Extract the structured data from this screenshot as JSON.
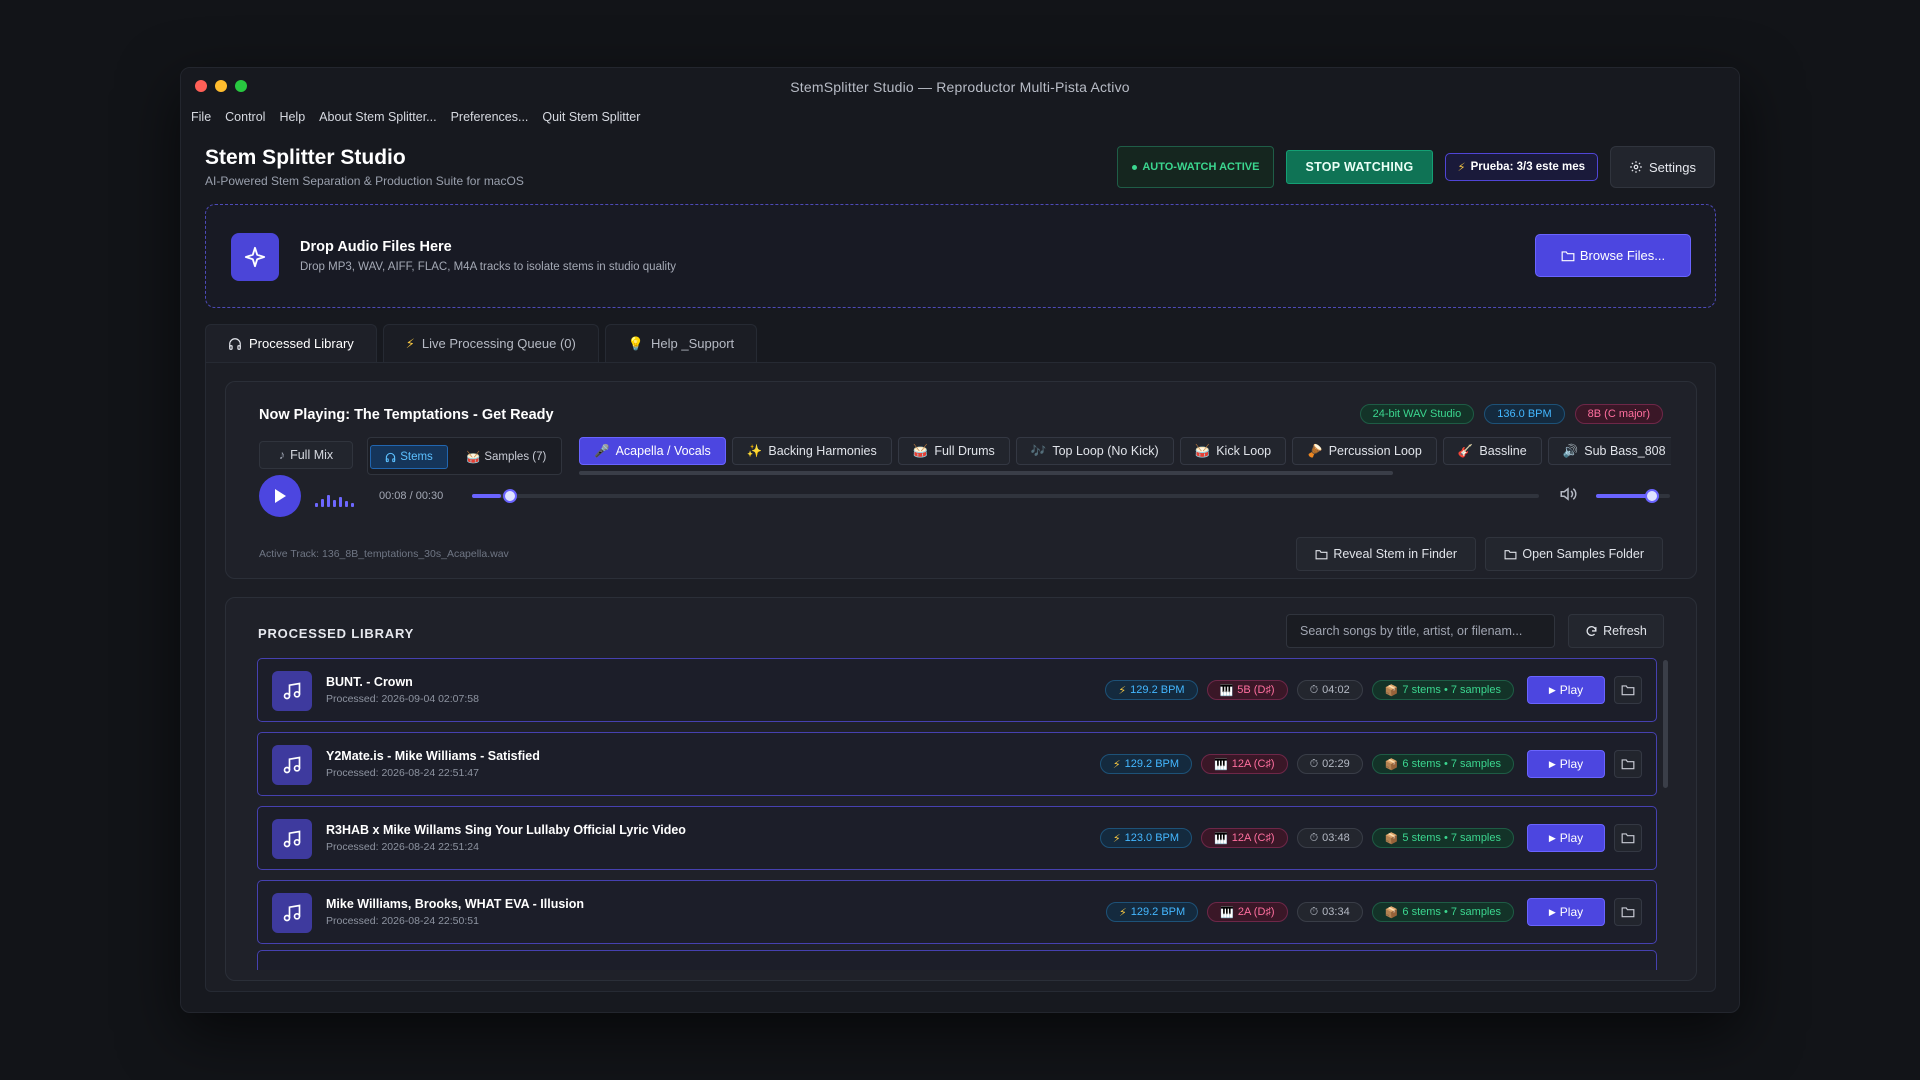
{
  "window": {
    "title": "StemSplitter Studio — Reproductor Multi-Pista Activo",
    "traffic_colors": [
      "#ff5f57",
      "#febc2e",
      "#28c840"
    ]
  },
  "menubar": [
    "File",
    "Control",
    "Help",
    "About Stem Splitter...",
    "Preferences...",
    "Quit Stem Splitter"
  ],
  "header": {
    "title": "Stem Splitter Studio",
    "subtitle": "AI-Powered Stem Separation & Production Suite for macOS",
    "auto_watch": "AUTO-WATCH ACTIVE",
    "stop_watching": "STOP WATCHING",
    "trial": "Prueba: 3/3 este mes",
    "settings": "Settings"
  },
  "dropzone": {
    "title": "Drop Audio Files Here",
    "subtitle": "Drop MP3, WAV, AIFF, FLAC, M4A tracks to isolate stems in studio quality",
    "browse": "Browse Files..."
  },
  "tabs": [
    {
      "label": "Processed Library",
      "icon": "headphones-icon",
      "active": true
    },
    {
      "label": "Live Processing Queue (0)",
      "icon": "lightning-icon",
      "active": false
    },
    {
      "label": "Help _Support",
      "icon": "lightbulb-icon",
      "active": false
    }
  ],
  "player": {
    "now_playing": "Now Playing: The Temptations - Get Ready",
    "badges": {
      "format": "24-bit WAV Studio",
      "bpm": "136.0 BPM",
      "key": "8B (C major)"
    },
    "full_mix": "Full Mix",
    "stems_toggle": "Stems",
    "samples_toggle": "Samples (7)",
    "stem_chips": [
      {
        "label": "Acapella / Vocals",
        "icon": "🎤",
        "active": true
      },
      {
        "label": "Backing Harmonies",
        "icon": "✨",
        "active": false
      },
      {
        "label": "Full Drums",
        "icon": "🥁",
        "active": false
      },
      {
        "label": "Top Loop (No Kick)",
        "icon": "🎶",
        "active": false
      },
      {
        "label": "Kick Loop",
        "icon": "🥁",
        "active": false
      },
      {
        "label": "Percussion Loop",
        "icon": "🪘",
        "active": false
      },
      {
        "label": "Bassline",
        "icon": "🎸",
        "active": false
      },
      {
        "label": "Sub Bass_808",
        "icon": "🔊",
        "active": false
      }
    ],
    "time": "00:08 / 00:30",
    "progress": 0.027,
    "volume": 0.75,
    "active_track": "Active Track: 136_8B_temptations_30s_Acapella.wav",
    "reveal": "Reveal Stem in Finder",
    "open_samples": "Open Samples Folder"
  },
  "library": {
    "title": "PROCESSED LIBRARY",
    "search_placeholder": "Search songs by title, artist, or filenam...",
    "refresh": "Refresh",
    "play_label": "Play",
    "rows": [
      {
        "title": "BUNT. - Crown",
        "date": "Processed: 2026-09-04 02:07:58",
        "bpm": "129.2 BPM",
        "key": "5B (D♯)",
        "duration": "04:02",
        "stems": "7 stems • 7 samples"
      },
      {
        "title": "Y2Mate.is - Mike Williams - Satisfied",
        "date": "Processed: 2026-08-24 22:51:47",
        "bpm": "129.2 BPM",
        "key": "12A (C♯)",
        "duration": "02:29",
        "stems": "6 stems • 7 samples"
      },
      {
        "title": "R3HAB x Mike Willams  Sing Your Lullaby Official Lyric Video",
        "date": "Processed: 2026-08-24 22:51:24",
        "bpm": "123.0 BPM",
        "key": "12A (C♯)",
        "duration": "03:48",
        "stems": "5 stems • 7 samples"
      },
      {
        "title": "Mike Williams, Brooks, WHAT EVA - Illusion",
        "date": "Processed: 2026-08-24 22:50:51",
        "bpm": "129.2 BPM",
        "key": "2A (D♯)",
        "duration": "03:34",
        "stems": "6 stems • 7 samples"
      }
    ]
  }
}
